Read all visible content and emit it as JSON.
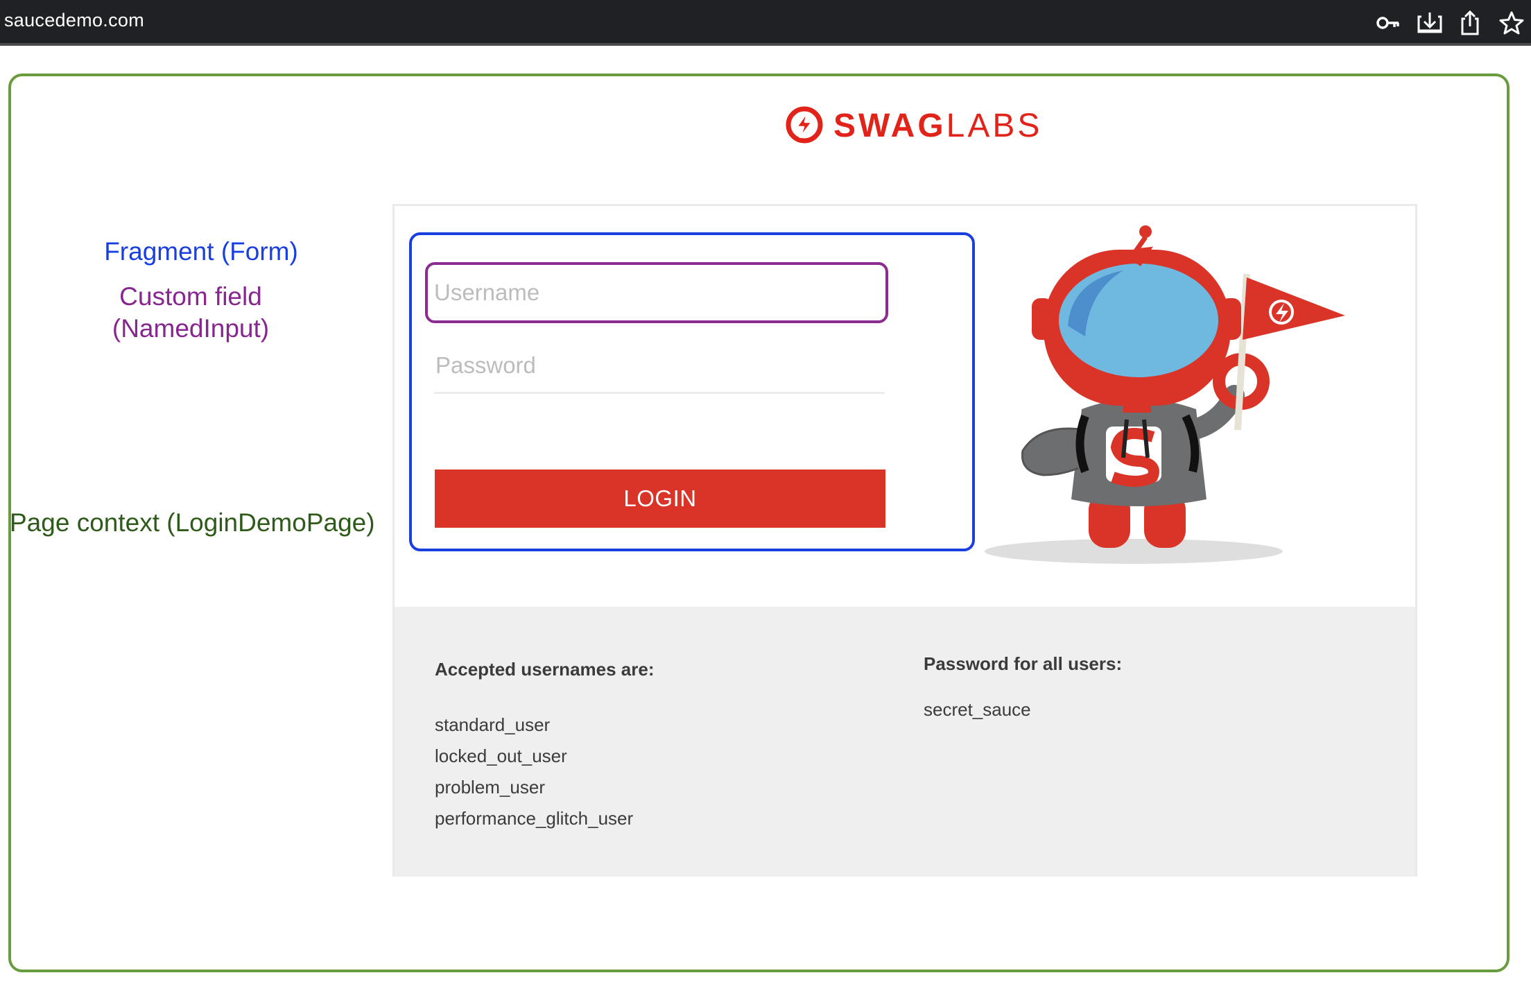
{
  "browser": {
    "url": "saucedemo.com",
    "icons": [
      "key-icon",
      "download-icon",
      "share-icon",
      "star-icon"
    ]
  },
  "annotations": {
    "fragment": "Fragment (Form)",
    "custom_field": "Custom field (NamedInput)",
    "page_context": "Page context (LoginDemoPage)"
  },
  "logo": {
    "bold": "SWAG",
    "light": "LABS",
    "icon": "swag-labs-logo-icon"
  },
  "form": {
    "username_placeholder": "Username",
    "password_placeholder": "Password",
    "login_label": "LOGIN"
  },
  "credentials": {
    "usernames_heading": "Accepted usernames are:",
    "usernames": [
      "standard_user",
      "locked_out_user",
      "problem_user",
      "performance_glitch_user"
    ],
    "password_heading": "Password for all users:",
    "password": "secret_sauce"
  },
  "colors": {
    "brand": "#e2231a",
    "login_button": "#d93427",
    "page_context_frame": "#6a9b3c",
    "fragment_frame": "#1a3fe0",
    "custom_field_frame": "#8a2c92"
  }
}
